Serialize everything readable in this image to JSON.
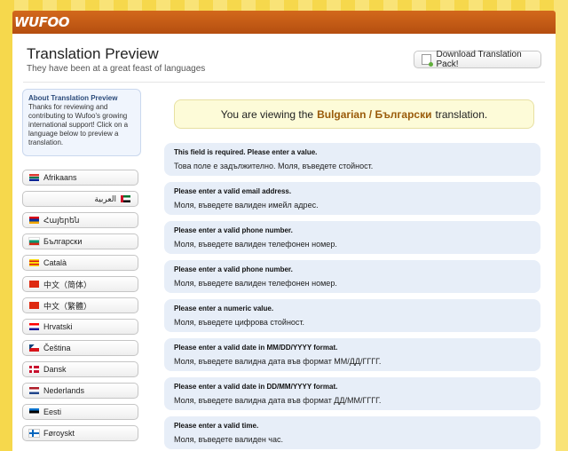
{
  "brand": "WUFOO",
  "colors": {
    "stripe_a": "#f6d84c",
    "stripe_b": "#f9e377",
    "header": "#c95e17",
    "accent": "#9a5b0a"
  },
  "header": {
    "title": "Translation Preview",
    "subtitle": "They have been at a great feast of languages",
    "download_label": "Download Translation Pack!"
  },
  "about": {
    "title": "About Translation Preview",
    "body": "Thanks for reviewing and contributing to Wufoo's growing international support! Click on a language below to preview a translation."
  },
  "languages": [
    {
      "label": "Afrikaans",
      "icon": "flag-za-icon"
    },
    {
      "label": "العربية",
      "icon": "flag-ae-icon"
    },
    {
      "label": "Հայերեն",
      "icon": "flag-am-icon"
    },
    {
      "label": "Български",
      "icon": "flag-bg-icon"
    },
    {
      "label": "Català",
      "icon": "flag-ct-icon"
    },
    {
      "label": "中文（简体）",
      "icon": "flag-cn-icon"
    },
    {
      "label": "中文（繁體）",
      "icon": "flag-tw-icon"
    },
    {
      "label": "Hrvatski",
      "icon": "flag-hr-icon"
    },
    {
      "label": "Čeština",
      "icon": "flag-cz-icon"
    },
    {
      "label": "Dansk",
      "icon": "flag-dk-icon"
    },
    {
      "label": "Nederlands",
      "icon": "flag-nl-icon"
    },
    {
      "label": "Eesti",
      "icon": "flag-ee-icon"
    },
    {
      "label": "Føroyskt",
      "icon": "flag-fo-icon"
    }
  ],
  "notice": {
    "prefix": "You are viewing the",
    "language": "Bulgarian / Български",
    "suffix": "translation."
  },
  "messages": [
    {
      "en": "This field is required. Please enter a value.",
      "bg": "Това поле е задължително. Моля, въведете стойност."
    },
    {
      "en": "Please enter a valid email address.",
      "bg": "Моля, въведете валиден имейл адрес."
    },
    {
      "en": "Please enter a valid phone number.",
      "bg": "Моля, въведете валиден телефонен номер."
    },
    {
      "en": "Please enter a valid phone number.",
      "bg": "Моля, въведете валиден телефонен номер."
    },
    {
      "en": "Please enter a numeric value.",
      "bg": "Моля, въведете цифрова стойност."
    },
    {
      "en": "Please enter a valid date in MM/DD/YYYY format.",
      "bg": "Моля, въведете валидна дата във формат ММ/ДД/ГГГГ."
    },
    {
      "en": "Please enter a valid date in DD/MM/YYYY format.",
      "bg": "Моля, въведете валидна дата във формат ДД/ММ/ГГГГ."
    },
    {
      "en": "Please enter a valid time.",
      "bg": "Моля, въведете валиден час."
    }
  ]
}
